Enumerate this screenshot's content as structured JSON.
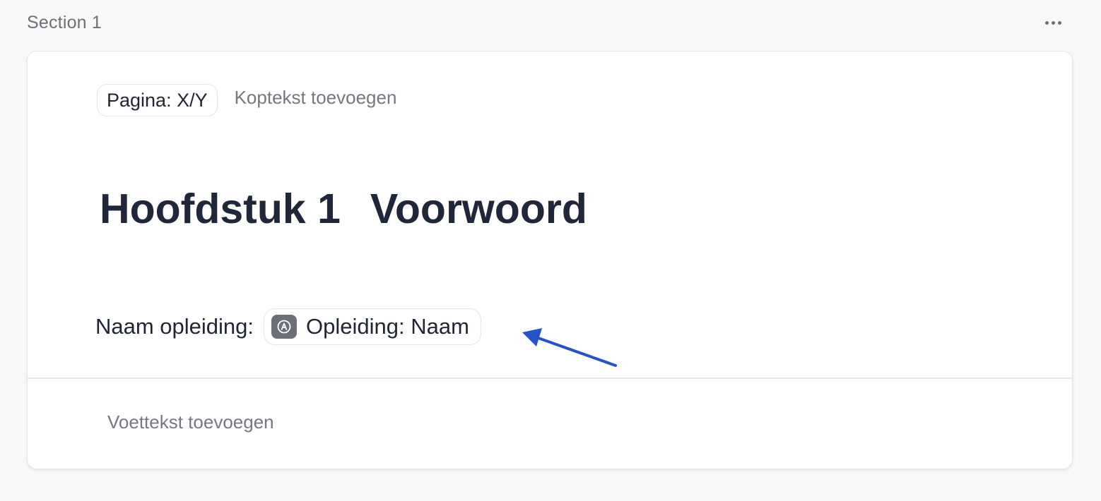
{
  "section": {
    "title": "Section 1",
    "more_icon": "more-horizontal-icon"
  },
  "header": {
    "page_chip": "Pagina: X/Y",
    "add_header": "Koptekst toevoegen"
  },
  "chapter": {
    "number": "Hoofdstuk 1",
    "title": "Voorwoord"
  },
  "field": {
    "label": "Naam opleiding:",
    "variable_icon": "variable-a-icon",
    "variable_value": "Opleiding: Naam"
  },
  "footer": {
    "add_footer": "Voettekst toevoegen"
  },
  "annotation": {
    "arrow_color": "#2352c9"
  },
  "colors": {
    "background": "#f8f8f9",
    "card": "#ffffff",
    "heading": "#20273a",
    "muted_text": "#757882"
  }
}
